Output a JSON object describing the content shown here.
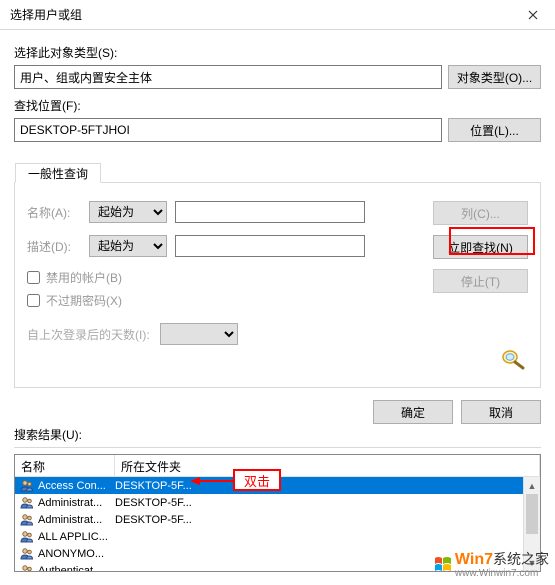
{
  "title": "选择用户或组",
  "objectType": {
    "label": "选择此对象类型(S):",
    "value": "用户、组或内置安全主体",
    "button": "对象类型(O)..."
  },
  "location": {
    "label": "查找位置(F):",
    "value": "DESKTOP-5FTJHOI",
    "button": "位置(L)..."
  },
  "tab": {
    "label": "一般性查询"
  },
  "form": {
    "name": {
      "label": "名称(A):",
      "select": "起始为"
    },
    "desc": {
      "label": "描述(D):",
      "select": "起始为"
    },
    "check1": "禁用的帐户(B)",
    "check2": "不过期密码(X)",
    "lastLogin": "自上次登录后的天数(I):"
  },
  "sideButtons": {
    "columns": "列(C)...",
    "findNow": "立即查找(N)",
    "stop": "停止(T)"
  },
  "actions": {
    "ok": "确定",
    "cancel": "取消"
  },
  "results": {
    "label": "搜索结果(U):"
  },
  "listHeader": {
    "name": "名称",
    "folder": "所在文件夹"
  },
  "listRows": [
    {
      "name": "Access Con...",
      "folder": "DESKTOP-5F..."
    },
    {
      "name": "Administrat...",
      "folder": "DESKTOP-5F..."
    },
    {
      "name": "Administrat...",
      "folder": "DESKTOP-5F..."
    },
    {
      "name": "ALL APPLIC...",
      "folder": ""
    },
    {
      "name": "ANONYMO...",
      "folder": ""
    },
    {
      "name": "Authenticat...",
      "folder": ""
    }
  ],
  "annotation": {
    "dblclick": "双击"
  },
  "watermark": {
    "brand": "Win7系统之家",
    "sub": "www.Winwin7.com"
  }
}
